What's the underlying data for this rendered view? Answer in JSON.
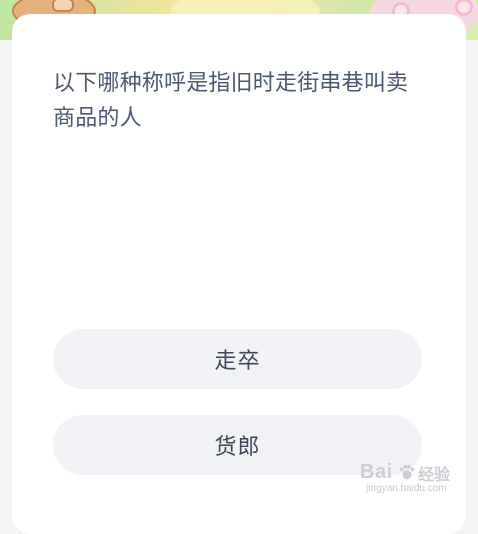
{
  "question": {
    "text": "以下哪种称呼是指旧时走街串巷叫卖商品的人"
  },
  "options": [
    {
      "label": "走卒"
    },
    {
      "label": "货郎"
    }
  ],
  "watermark": {
    "brand": "Bai",
    "brand_suffix": "经验",
    "url": "jingyan.baidu.com",
    "icon": "baidu-paw-icon"
  }
}
